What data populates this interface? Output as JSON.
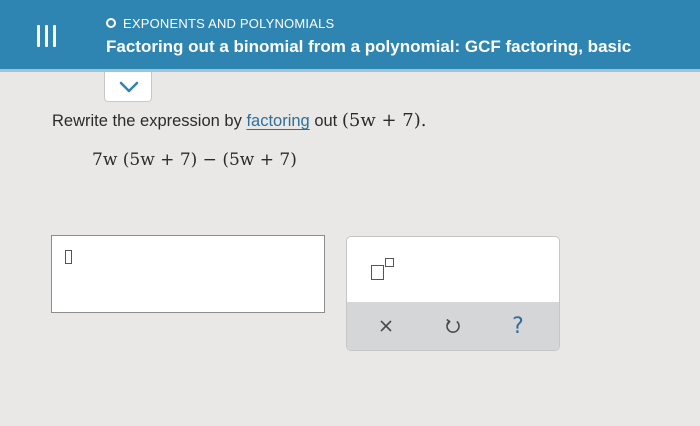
{
  "header": {
    "topic": "EXPONENTS AND POLYNOMIALS",
    "title": "Factoring out a binomial from a polynomial: GCF factoring, basic"
  },
  "question": {
    "prompt_before": "Rewrite the expression by ",
    "prompt_link": "factoring",
    "prompt_after": " out ",
    "factor": "(5w + 7).",
    "expression": "7w (5w + 7) − (5w + 7)"
  },
  "answer": {
    "value": ""
  },
  "toolbar": {
    "buttons": [
      "exponent-icon",
      "clear-icon",
      "undo-icon",
      "help-icon"
    ],
    "help_label": "?"
  },
  "colors": {
    "header": "#2f85b1",
    "link": "#2f6f99",
    "background": "#e9e8e6"
  }
}
